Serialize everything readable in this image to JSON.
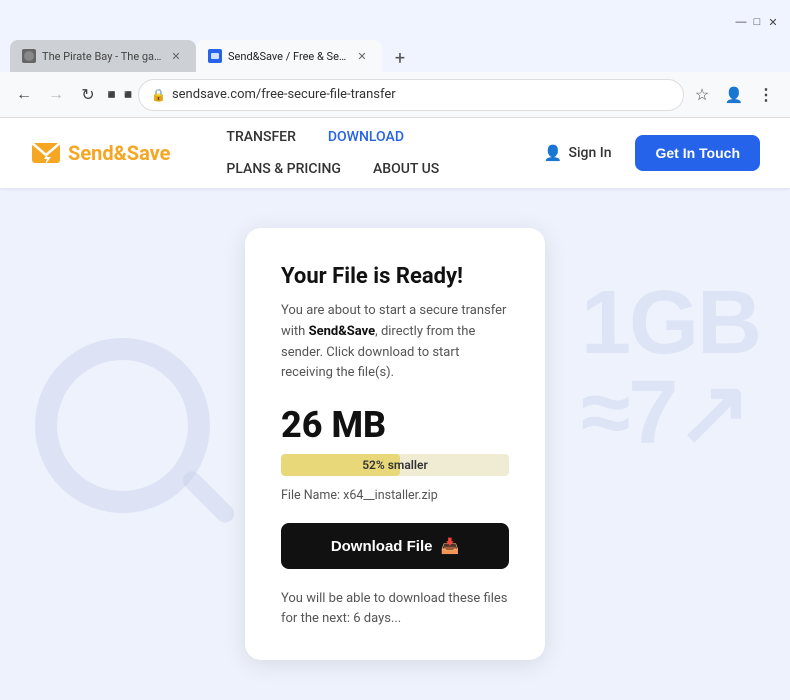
{
  "browser": {
    "tabs": [
      {
        "id": "tab1",
        "label": "The Pirate Bay - The galaxy's m...",
        "favicon": "pirate",
        "active": false
      },
      {
        "id": "tab2",
        "label": "Send&Save / Free & Secure Fi...",
        "favicon": "send",
        "active": true
      }
    ],
    "new_tab_label": "+",
    "nav": {
      "back_disabled": false,
      "forward_disabled": true,
      "reload": "⟳",
      "extensions": "⊞"
    },
    "address_bar": {
      "lock_icon": "🔒",
      "url": "sendsave.com/free-secure-file-transfer"
    },
    "nav_right": {
      "bookmark_icon": "☆",
      "profile_icon": "👤",
      "menu_icon": "⋮"
    },
    "window_controls": {
      "minimize": "—",
      "maximize": "□",
      "close": "✕"
    }
  },
  "header": {
    "logo_text_part1": "Send",
    "logo_text_part2": "Save",
    "nav_items": [
      {
        "label": "TRANSFER",
        "active": false
      },
      {
        "label": "DOWNLOAD",
        "active": true
      },
      {
        "label": "PLANS & PRICING",
        "active": false
      },
      {
        "label": "ABOUT US",
        "active": false
      }
    ],
    "sign_in_label": "Sign In",
    "get_in_touch_label": "Get In Touch"
  },
  "card": {
    "title": "Your File is Ready!",
    "description_plain": "You are about to start a secure transfer with ",
    "description_brand": "Send&Save",
    "description_rest": ", directly from the sender. Click download to start receiving the file(s).",
    "file_size": "26 MB",
    "progress_percent": 52,
    "progress_label": "52% smaller",
    "file_name_label": "File Name: x64__installer.zip",
    "download_btn_label": "Download File",
    "download_icon": "📥",
    "expiry_text": "You will be able to download these files for the next: 6 days..."
  },
  "bg": {
    "text": "1GB≈7↗"
  }
}
